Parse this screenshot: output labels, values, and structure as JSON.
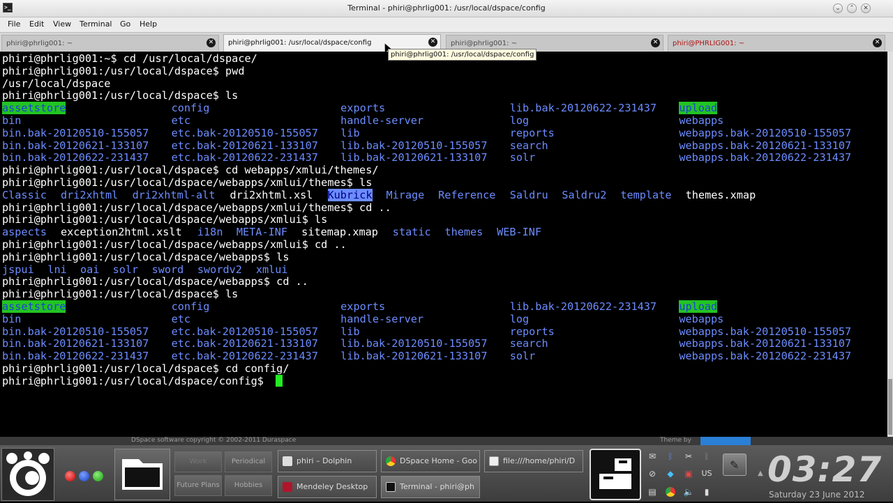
{
  "window": {
    "title": "Terminal - phiri@phrlig001: /usr/local/dspace/config",
    "buttons": {
      "minimize": "⌄",
      "maximize": "⌃",
      "close": "✕"
    }
  },
  "menu": [
    "File",
    "Edit",
    "View",
    "Terminal",
    "Go",
    "Help"
  ],
  "tabs": [
    {
      "label": "phiri@phrlig001: ~",
      "active": false
    },
    {
      "label": "phiri@phrlig001: /usr/local/dspace/config",
      "active": true
    },
    {
      "label": "phiri@phrlig001: ~",
      "active": false
    },
    {
      "label": "phiri@PHRLIG001: ~",
      "active": false,
      "color": "#b01414"
    }
  ],
  "tooltip": "phiri@phrlig001: /usr/local/dspace/config",
  "terminal": {
    "lines": [
      [
        {
          "t": "phiri@phrlig001:~$ cd /usr/local/dspace/",
          "c": "file",
          "col": 0
        }
      ],
      [
        {
          "t": "phiri@phrlig001:/usr/local/dspace$ pwd",
          "c": "file",
          "col": 0
        }
      ],
      [
        {
          "t": "/usr/local/dspace",
          "c": "file",
          "col": 0
        }
      ],
      [
        {
          "t": "phiri@phrlig001:/usr/local/dspace$ ls",
          "c": "file",
          "col": 0
        }
      ],
      [
        {
          "t": "assetstore",
          "c": "hl-green",
          "col": 0
        },
        {
          "t": "config",
          "c": "dir",
          "col": 26
        },
        {
          "t": "exports",
          "c": "dir",
          "col": 52
        },
        {
          "t": "lib.bak-20120622-231437",
          "c": "dir",
          "col": 78
        },
        {
          "t": "upload",
          "c": "hl-green",
          "col": 104
        }
      ],
      [
        {
          "t": "bin",
          "c": "dir",
          "col": 0
        },
        {
          "t": "etc",
          "c": "dir",
          "col": 26
        },
        {
          "t": "handle-server",
          "c": "dir",
          "col": 52
        },
        {
          "t": "log",
          "c": "dir",
          "col": 78
        },
        {
          "t": "webapps",
          "c": "dir",
          "col": 104
        }
      ],
      [
        {
          "t": "bin.bak-20120510-155057",
          "c": "dir",
          "col": 0
        },
        {
          "t": "etc.bak-20120510-155057",
          "c": "dir",
          "col": 26
        },
        {
          "t": "lib",
          "c": "dir",
          "col": 52
        },
        {
          "t": "reports",
          "c": "dir",
          "col": 78
        },
        {
          "t": "webapps.bak-20120510-155057",
          "c": "dir",
          "col": 104
        }
      ],
      [
        {
          "t": "bin.bak-20120621-133107",
          "c": "dir",
          "col": 0
        },
        {
          "t": "etc.bak-20120621-133107",
          "c": "dir",
          "col": 26
        },
        {
          "t": "lib.bak-20120510-155057",
          "c": "dir",
          "col": 52
        },
        {
          "t": "search",
          "c": "dir",
          "col": 78
        },
        {
          "t": "webapps.bak-20120621-133107",
          "c": "dir",
          "col": 104
        }
      ],
      [
        {
          "t": "bin.bak-20120622-231437",
          "c": "dir",
          "col": 0
        },
        {
          "t": "etc.bak-20120622-231437",
          "c": "dir",
          "col": 26
        },
        {
          "t": "lib.bak-20120621-133107",
          "c": "dir",
          "col": 52
        },
        {
          "t": "solr",
          "c": "dir",
          "col": 78
        },
        {
          "t": "webapps.bak-20120622-231437",
          "c": "dir",
          "col": 104
        }
      ],
      [
        {
          "t": "phiri@phrlig001:/usr/local/dspace$ cd webapps/xmlui/themes/",
          "c": "file",
          "col": 0
        }
      ],
      [
        {
          "t": "phiri@phrlig001:/usr/local/dspace/webapps/xmlui/themes$ ls",
          "c": "file",
          "col": 0
        }
      ],
      [
        {
          "t": "Classic",
          "c": "dir",
          "col": 0
        },
        {
          "t": "dri2xhtml",
          "c": "dir",
          "col": 9
        },
        {
          "t": "dri2xhtml-alt",
          "c": "dir",
          "col": 20
        },
        {
          "t": "dri2xhtml.xsl",
          "c": "file",
          "col": 35
        },
        {
          "t": "Kubrick",
          "c": "hl-blue",
          "col": 50
        },
        {
          "t": "Mirage",
          "c": "dir",
          "col": 59
        },
        {
          "t": "Reference",
          "c": "dir",
          "col": 67
        },
        {
          "t": "Saldru",
          "c": "dir",
          "col": 78
        },
        {
          "t": "Saldru2",
          "c": "dir",
          "col": 86
        },
        {
          "t": "template",
          "c": "dir",
          "col": 95
        },
        {
          "t": "themes.xmap",
          "c": "file",
          "col": 105
        }
      ],
      [
        {
          "t": "phiri@phrlig001:/usr/local/dspace/webapps/xmlui/themes$ cd ..",
          "c": "file",
          "col": 0
        }
      ],
      [
        {
          "t": "phiri@phrlig001:/usr/local/dspace/webapps/xmlui$ ls",
          "c": "file",
          "col": 0
        }
      ],
      [
        {
          "t": "aspects",
          "c": "dir",
          "col": 0
        },
        {
          "t": "exception2html.xslt",
          "c": "file",
          "col": 9
        },
        {
          "t": "i18n",
          "c": "dir",
          "col": 30
        },
        {
          "t": "META-INF",
          "c": "dir",
          "col": 36
        },
        {
          "t": "sitemap.xmap",
          "c": "file",
          "col": 46
        },
        {
          "t": "static",
          "c": "dir",
          "col": 60
        },
        {
          "t": "themes",
          "c": "dir",
          "col": 68
        },
        {
          "t": "WEB-INF",
          "c": "dir",
          "col": 76
        }
      ],
      [
        {
          "t": "phiri@phrlig001:/usr/local/dspace/webapps/xmlui$ cd ..",
          "c": "file",
          "col": 0
        }
      ],
      [
        {
          "t": "phiri@phrlig001:/usr/local/dspace/webapps$ ls",
          "c": "file",
          "col": 0
        }
      ],
      [
        {
          "t": "jspui",
          "c": "dir",
          "col": 0
        },
        {
          "t": "lni",
          "c": "dir",
          "col": 7
        },
        {
          "t": "oai",
          "c": "dir",
          "col": 12
        },
        {
          "t": "solr",
          "c": "dir",
          "col": 17
        },
        {
          "t": "sword",
          "c": "dir",
          "col": 23
        },
        {
          "t": "swordv2",
          "c": "dir",
          "col": 30
        },
        {
          "t": "xmlui",
          "c": "dir",
          "col": 39
        }
      ],
      [
        {
          "t": "phiri@phrlig001:/usr/local/dspace/webapps$ cd ..",
          "c": "file",
          "col": 0
        }
      ],
      [
        {
          "t": "phiri@phrlig001:/usr/local/dspace$ ls",
          "c": "file",
          "col": 0
        }
      ],
      [
        {
          "t": "assetstore",
          "c": "hl-green",
          "col": 0
        },
        {
          "t": "config",
          "c": "dir",
          "col": 26
        },
        {
          "t": "exports",
          "c": "dir",
          "col": 52
        },
        {
          "t": "lib.bak-20120622-231437",
          "c": "dir",
          "col": 78
        },
        {
          "t": "upload",
          "c": "hl-green",
          "col": 104
        }
      ],
      [
        {
          "t": "bin",
          "c": "dir",
          "col": 0
        },
        {
          "t": "etc",
          "c": "dir",
          "col": 26
        },
        {
          "t": "handle-server",
          "c": "dir",
          "col": 52
        },
        {
          "t": "log",
          "c": "dir",
          "col": 78
        },
        {
          "t": "webapps",
          "c": "dir",
          "col": 104
        }
      ],
      [
        {
          "t": "bin.bak-20120510-155057",
          "c": "dir",
          "col": 0
        },
        {
          "t": "etc.bak-20120510-155057",
          "c": "dir",
          "col": 26
        },
        {
          "t": "lib",
          "c": "dir",
          "col": 52
        },
        {
          "t": "reports",
          "c": "dir",
          "col": 78
        },
        {
          "t": "webapps.bak-20120510-155057",
          "c": "dir",
          "col": 104
        }
      ],
      [
        {
          "t": "bin.bak-20120621-133107",
          "c": "dir",
          "col": 0
        },
        {
          "t": "etc.bak-20120621-133107",
          "c": "dir",
          "col": 26
        },
        {
          "t": "lib.bak-20120510-155057",
          "c": "dir",
          "col": 52
        },
        {
          "t": "search",
          "c": "dir",
          "col": 78
        },
        {
          "t": "webapps.bak-20120621-133107",
          "c": "dir",
          "col": 104
        }
      ],
      [
        {
          "t": "bin.bak-20120622-231437",
          "c": "dir",
          "col": 0
        },
        {
          "t": "etc.bak-20120622-231437",
          "c": "dir",
          "col": 26
        },
        {
          "t": "lib.bak-20120621-133107",
          "c": "dir",
          "col": 52
        },
        {
          "t": "solr",
          "c": "dir",
          "col": 78
        },
        {
          "t": "webapps.bak-20120622-231437",
          "c": "dir",
          "col": 104
        }
      ],
      [
        {
          "t": "phiri@phrlig001:/usr/local/dspace$ cd config/",
          "c": "file",
          "col": 0
        }
      ],
      [
        {
          "t": "phiri@phrlig001:/usr/local/dspace/config$ ",
          "c": "file",
          "col": 0
        }
      ]
    ],
    "colors": {
      "directory": "#6c8cff",
      "highlight_green": "#22c422",
      "highlight_blue": "#6c8cff",
      "cursor": "#22ee22"
    }
  },
  "behind_window": {
    "text": "DSpace software copyright © 2002-2011  Duraspace",
    "theme_text": "Theme by"
  },
  "taskbar": {
    "workspaces": [
      "Work",
      "Periodical",
      "Future Plans",
      "Hobbies"
    ],
    "tasks": [
      {
        "label": "phiri – Dolphin",
        "icon": "dolphin-icon"
      },
      {
        "label": "DSpace Home - Goo",
        "icon": "chrome-icon"
      },
      {
        "label": "file:///home/phiri/D",
        "icon": "document-icon"
      },
      {
        "label": "Mendeley Desktop",
        "icon": "mendeley-icon"
      },
      {
        "label": "Terminal - phiri@ph",
        "icon": "terminal-icon"
      }
    ],
    "keyboard_layout": "US",
    "clock": "03:27",
    "date": "Saturday 23 June 2012"
  }
}
